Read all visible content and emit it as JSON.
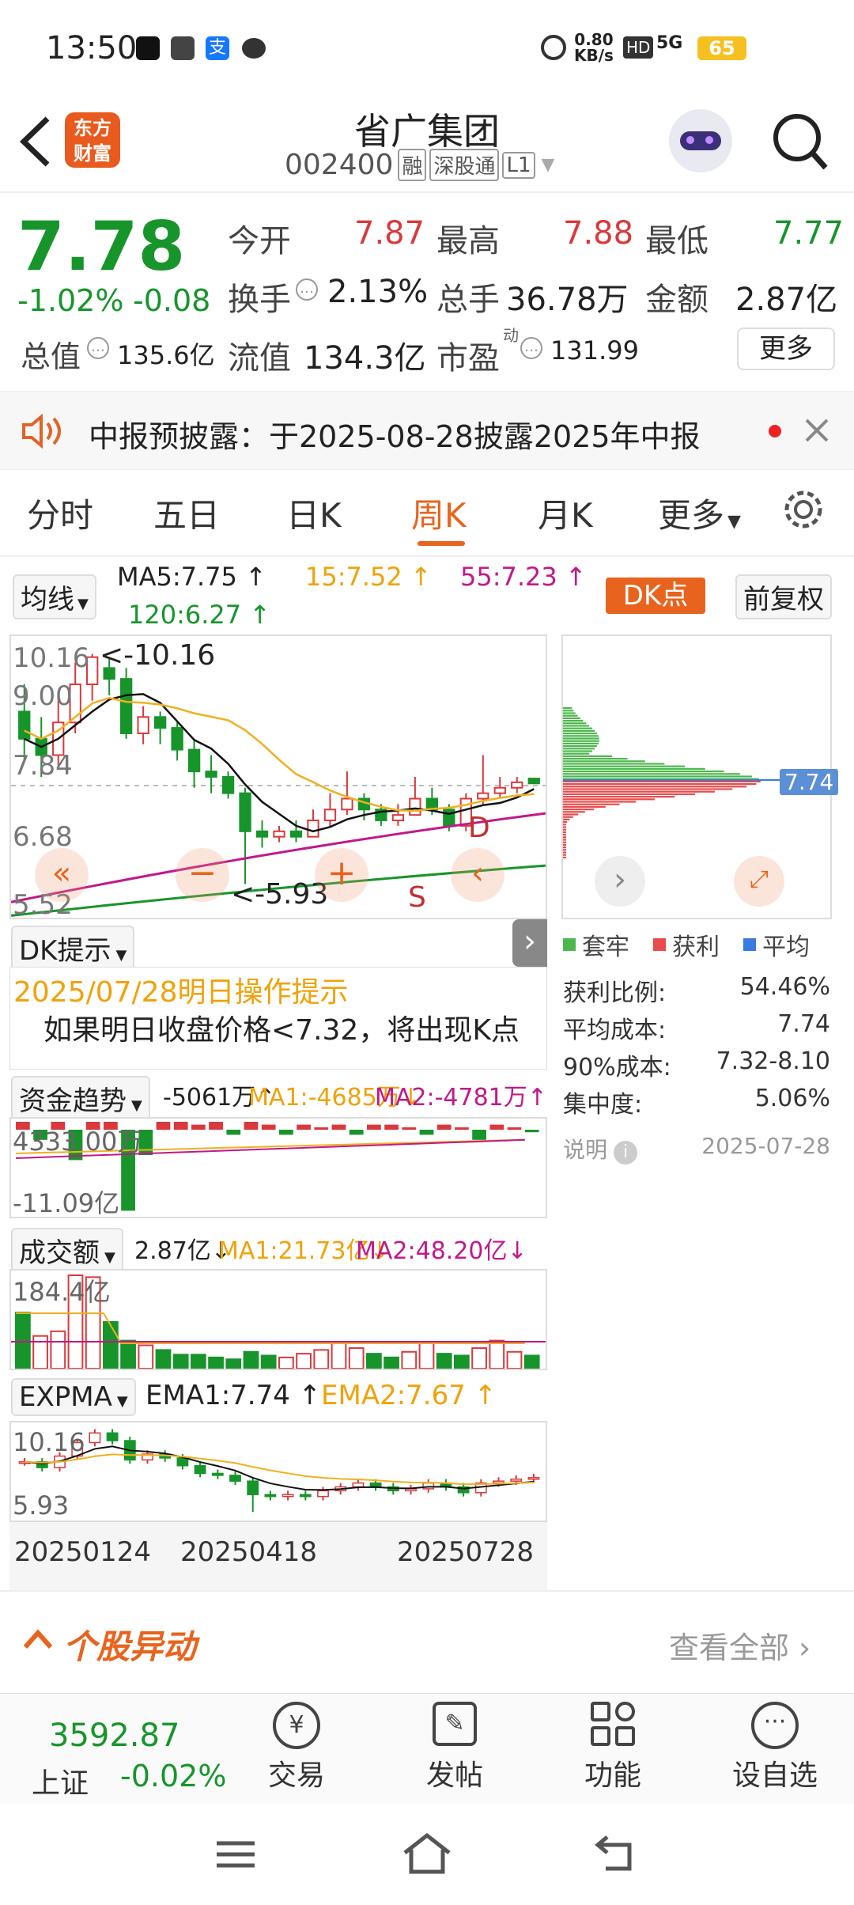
{
  "status": {
    "time": "13:50",
    "net_speed_top": "0.80",
    "net_speed_bottom": "KB/s",
    "hd": "HD",
    "sig": "5G",
    "battery": "65"
  },
  "header": {
    "title": "省广集团",
    "code": "002400",
    "tag1": "融",
    "tag2": "深股通",
    "tag3": "L1",
    "logo_line1": "东方",
    "logo_line2": "财富"
  },
  "quote": {
    "price": "7.78",
    "change_pct": "-1.02%",
    "change": "-0.08",
    "open_label": "今开",
    "open": "7.87",
    "high_label": "最高",
    "high": "7.88",
    "low_label": "最低",
    "low": "7.77",
    "turnover_label": "换手",
    "turnover": "2.13%",
    "volume_label": "总手",
    "volume": "36.78万",
    "amount_label": "金额",
    "amount": "2.87亿",
    "total_cap_label": "总值",
    "total_cap": "135.6亿",
    "float_cap_label": "流值",
    "float_cap": "134.3亿",
    "pe_label": "市盈",
    "pe_sup": "动",
    "pe": "131.99",
    "more": "更多"
  },
  "notice": {
    "text": "中报预披露：于2025-08-28披露2025年中报"
  },
  "tabs": [
    "分时",
    "五日",
    "日K",
    "周K",
    "月K",
    "更多"
  ],
  "active_tab": "周K",
  "ma_bar": {
    "select": "均线",
    "ma5": "MA5:7.75 ↑",
    "ma15": "15:7.52 ↑",
    "ma55": "55:7.23 ↑",
    "ma120": "120:6.27 ↑",
    "dk": "DK点",
    "fq": "前复权"
  },
  "main_chart": {
    "y_labels": [
      "10.16",
      "9.00",
      "7.84",
      "6.68",
      "5.52"
    ],
    "max_note": "<-10.16",
    "min_note": "<-5.93",
    "mark_d": "D",
    "mark_s": "S"
  },
  "chip": {
    "price_tag": "7.74",
    "legend": [
      "套牢",
      "获利",
      "平均"
    ],
    "rows": [
      {
        "k": "获利比例:",
        "v": "54.46%"
      },
      {
        "k": "平均成本:",
        "v": "7.74"
      },
      {
        "k": "90%成本:",
        "v": "7.32-8.10"
      },
      {
        "k": "集中度:",
        "v": "5.06%"
      }
    ],
    "note_label": "说明",
    "note_date": "2025-07-28"
  },
  "dk": {
    "select": "DK提示",
    "date_title": "2025/07/28明日操作提示",
    "text": "如果明日收盘价格<7.32，将出现K点"
  },
  "fund": {
    "select": "资金趋势",
    "value": "-5061万↑",
    "ma1": "MA1:-4685万↓",
    "ma2": "MA2:-4781万↑",
    "top": "4333.00万",
    "bottom": "-11.09亿"
  },
  "vol": {
    "select": "成交额",
    "value": "2.87亿↓",
    "ma1": "MA1:21.73亿↓",
    "ma2": "MA2:48.20亿↓",
    "top": "184.4亿"
  },
  "expma": {
    "select": "EXPMA",
    "ema1": "EMA1:7.74 ↑",
    "ema2": "EMA2:7.67 ↑",
    "top": "10.16",
    "bottom": "5.93"
  },
  "dates": [
    "20250124",
    "20250418",
    "20250728"
  ],
  "movers": {
    "title": "个股异动",
    "all": "查看全部"
  },
  "bottom": {
    "index_value": "3592.87",
    "index_name": "上证",
    "index_change": "-0.02%",
    "items": [
      "交易",
      "发帖",
      "功能",
      "设自选"
    ]
  },
  "colors": {
    "accent": "#ee6a1f",
    "up": "#d9393c",
    "down": "#17952b"
  }
}
